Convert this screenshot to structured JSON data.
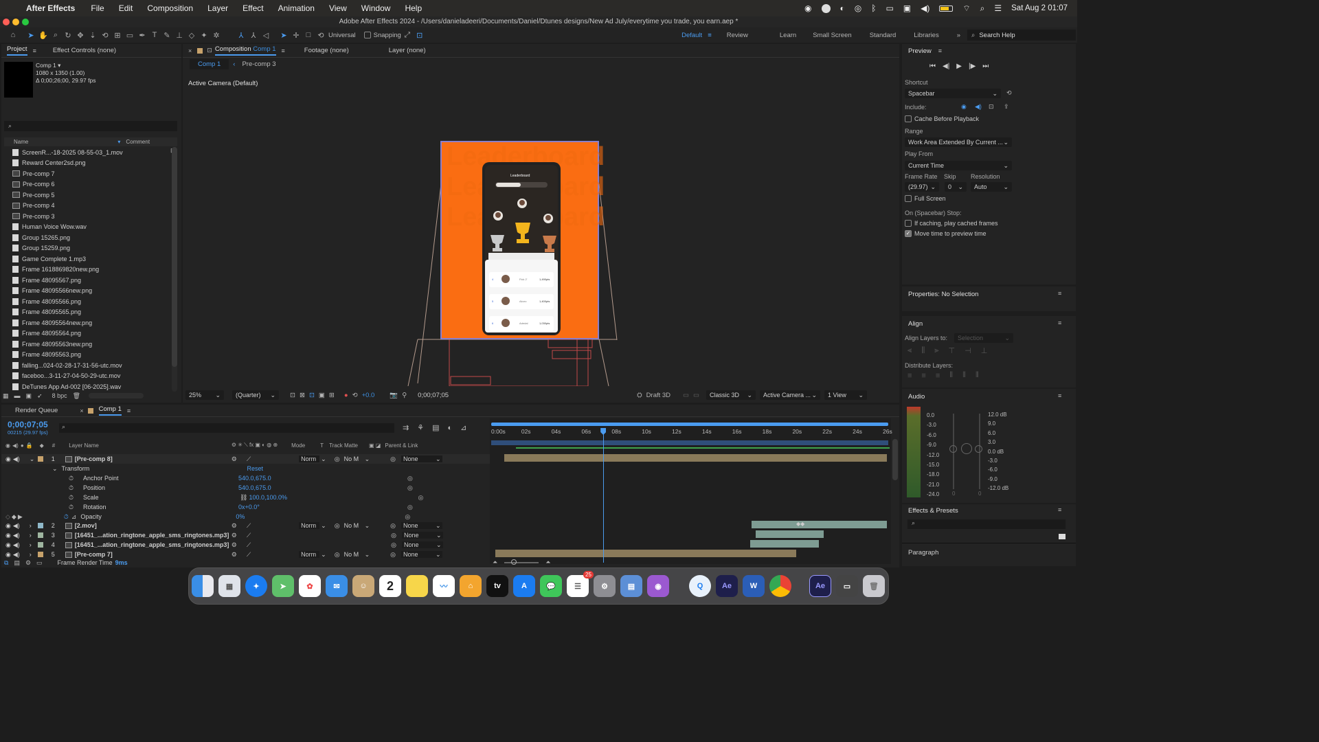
{
  "menubar": {
    "app": "After Effects",
    "items": [
      "File",
      "Edit",
      "Composition",
      "Layer",
      "Effect",
      "Animation",
      "View",
      "Window",
      "Help"
    ],
    "clock": "Sat Aug 2  01:07"
  },
  "window": {
    "title": "Adobe After Effects 2024 - /Users/danieladeeri/Documents/Daniel/Dtunes designs/New Ad July/everytime you trade, you earn.aep *"
  },
  "toolbar": {
    "universal_label": "Universal",
    "snapping_label": "Snapping",
    "workspaces": [
      "Default",
      "Review",
      "Learn",
      "Small Screen",
      "Standard",
      "Libraries"
    ],
    "active_workspace": "Default",
    "search_placeholder": "Search Help"
  },
  "project": {
    "tab_project": "Project",
    "tab_effect_controls": "Effect Controls (none)",
    "comp_name": "Comp 1 ▾",
    "comp_info1": "1080 x 1350 (1.00)",
    "comp_info2": "Δ 0;00;26;00, 29.97 fps",
    "col_name": "Name",
    "col_comment": "Comment",
    "bpc": "8 bpc",
    "items": [
      {
        "name": "ScreenR...-18-2025 08-55-03_1.mov",
        "kind": "file"
      },
      {
        "name": "Reward Center2sd.png",
        "kind": "file"
      },
      {
        "name": "Pre-comp 7",
        "kind": "comp"
      },
      {
        "name": "Pre-comp 6",
        "kind": "comp"
      },
      {
        "name": "Pre-comp 5",
        "kind": "comp"
      },
      {
        "name": "Pre-comp 4",
        "kind": "comp"
      },
      {
        "name": "Pre-comp 3",
        "kind": "comp"
      },
      {
        "name": "Human Voice Wow.wav",
        "kind": "file"
      },
      {
        "name": "Group 15265.png",
        "kind": "file"
      },
      {
        "name": "Group 15259.png",
        "kind": "file"
      },
      {
        "name": "Game Complete 1.mp3",
        "kind": "file"
      },
      {
        "name": "Frame 1618869820new.png",
        "kind": "file"
      },
      {
        "name": "Frame 48095567.png",
        "kind": "file"
      },
      {
        "name": "Frame 48095566new.png",
        "kind": "file"
      },
      {
        "name": "Frame 48095566.png",
        "kind": "file"
      },
      {
        "name": "Frame 48095565.png",
        "kind": "file"
      },
      {
        "name": "Frame 48095564new.png",
        "kind": "file"
      },
      {
        "name": "Frame 48095564.png",
        "kind": "file"
      },
      {
        "name": "Frame 48095563new.png",
        "kind": "file"
      },
      {
        "name": "Frame 48095563.png",
        "kind": "file"
      },
      {
        "name": "falling...024-02-28-17-31-56-utc.mov",
        "kind": "file"
      },
      {
        "name": "faceboo...3-11-27-04-50-29-utc.mov",
        "kind": "file"
      },
      {
        "name": "DeTunes App Ad-002 [06-2025].wav",
        "kind": "file"
      }
    ]
  },
  "viewer": {
    "tab_composition": "Composition",
    "tab_comp_name": "Comp 1",
    "tab_footage": "Footage (none)",
    "tab_layer": "Layer (none)",
    "crumb1": "Comp 1",
    "crumb2": "Pre-comp 3",
    "camera_label": "Active Camera (Default)",
    "zoom": "25%",
    "resolution": "(Quarter)",
    "exposure": "+0.0",
    "timecode": "0;00;07;05",
    "draft3d": "Draft 3D",
    "renderer": "Classic 3D",
    "camera": "Active Camera ...",
    "views": "1 View",
    "canvas_watermark": "Leaderboard",
    "phone_title": "Leaderboard",
    "phone_rows": [
      {
        "rank": "4",
        "name": "Fick 2'",
        "score": "1,490pts"
      },
      {
        "rank": "5",
        "name": "Akoro",
        "score": "1,400pts"
      },
      {
        "rank": "6",
        "name": "Adedal",
        "score": "1,030pts"
      }
    ],
    "colors": {
      "orange": "#fa6d12",
      "accent": "#3d8fe0"
    }
  },
  "preview": {
    "title": "Preview",
    "shortcut_label": "Shortcut",
    "shortcut_value": "Spacebar",
    "include_label": "Include:",
    "cache_label": "Cache Before Playback",
    "range_label": "Range",
    "range_value": "Work Area Extended By Current ...",
    "playfrom_label": "Play From",
    "playfrom_value": "Current Time",
    "framerate_label": "Frame Rate",
    "skip_label": "Skip",
    "resolution_label": "Resolution",
    "framerate_value": "(29.97)",
    "skip_value": "0",
    "resolution_value": "Auto",
    "fullscreen_label": "Full Screen",
    "stop_label": "On (Spacebar) Stop:",
    "caching_label": "If caching, play cached frames",
    "movetime_label": "Move time to preview time",
    "movetime_checked": true
  },
  "properties": {
    "title": "Properties: No Selection"
  },
  "align": {
    "title": "Align",
    "align_to_label": "Align Layers to:",
    "align_to_value": "Selection",
    "distribute_label": "Distribute Layers:"
  },
  "audio": {
    "title": "Audio",
    "left_scale": [
      "0.0",
      "-3.0",
      "-6.0",
      "-9.0",
      "-12.0",
      "-15.0",
      "-18.0",
      "-21.0",
      "-24.0"
    ],
    "right_scale": [
      "12.0 dB",
      "9.0",
      "6.0",
      "3.0",
      "0.0 dB",
      "-3.0",
      "-6.0",
      "-9.0",
      "-12.0 dB"
    ],
    "slider_zero": "0"
  },
  "effects": {
    "title": "Effects & Presets",
    "paragraph": "Paragraph"
  },
  "timeline": {
    "tab_render": "Render Queue",
    "tab_comp": "Comp 1",
    "timecode": "0;00;07;05",
    "frame_info": "00215 (29.97 fps)",
    "col_num": "#",
    "col_layer": "Layer Name",
    "col_mode": "Mode",
    "col_t": "T",
    "col_trackmatte": "Track Matte",
    "col_parent": "Parent & Link",
    "ruler": [
      "0:00s",
      "02s",
      "04s",
      "06s",
      "08s",
      "10s",
      "12s",
      "14s",
      "16s",
      "18s",
      "20s",
      "22s",
      "24s",
      "26s"
    ],
    "playhead_seconds": 7.17,
    "duration_seconds": 26,
    "layers": [
      {
        "num": "1",
        "name": "[Pre-comp 8]",
        "mode": "Norm",
        "matte": "No M",
        "parent": "None",
        "start": 0.6,
        "end": 26
      },
      {
        "num": "2",
        "name": "[2.mov]",
        "mode": "Norm",
        "matte": "No M",
        "parent": "None",
        "start": 17,
        "end": 26
      },
      {
        "num": "3",
        "name": "[16451_...ation_ringtone_apple_sms_ringtones.mp3]",
        "mode": "",
        "matte": "",
        "parent": "None",
        "start": 17.3,
        "end": 21.8
      },
      {
        "num": "4",
        "name": "[16451_...ation_ringtone_apple_sms_ringtones.mp3]",
        "mode": "",
        "matte": "",
        "parent": "None",
        "start": 16.9,
        "end": 21.5
      },
      {
        "num": "5",
        "name": "[Pre-comp 7]",
        "mode": "Norm",
        "matte": "No M",
        "parent": "None",
        "start": 0,
        "end": 20
      }
    ],
    "transform_label": "Transform",
    "reset_label": "Reset",
    "props": [
      {
        "name": "Anchor Point",
        "value": "540.0,675.0"
      },
      {
        "name": "Position",
        "value": "540.0,675.0"
      },
      {
        "name": "Scale",
        "value": "100.0,100.0%"
      },
      {
        "name": "Rotation",
        "value": "0x+0.0°"
      },
      {
        "name": "Opacity",
        "value": "0%"
      }
    ],
    "footer_label": "Frame Render Time",
    "footer_value": "9ms"
  },
  "dock": {
    "badge": "25",
    "calendar_day": "2",
    "apps": [
      "finder",
      "launchpad",
      "safari",
      "maps",
      "photos",
      "mail",
      "contacts",
      "calendar",
      "notes",
      "freeform",
      "home",
      "tv",
      "appstore",
      "messages",
      "reminders",
      "settings",
      "preview",
      "podcasts",
      "quicktime",
      "aftereffects",
      "word",
      "chrome",
      "ae-doc",
      "screenshot",
      "trash"
    ]
  }
}
